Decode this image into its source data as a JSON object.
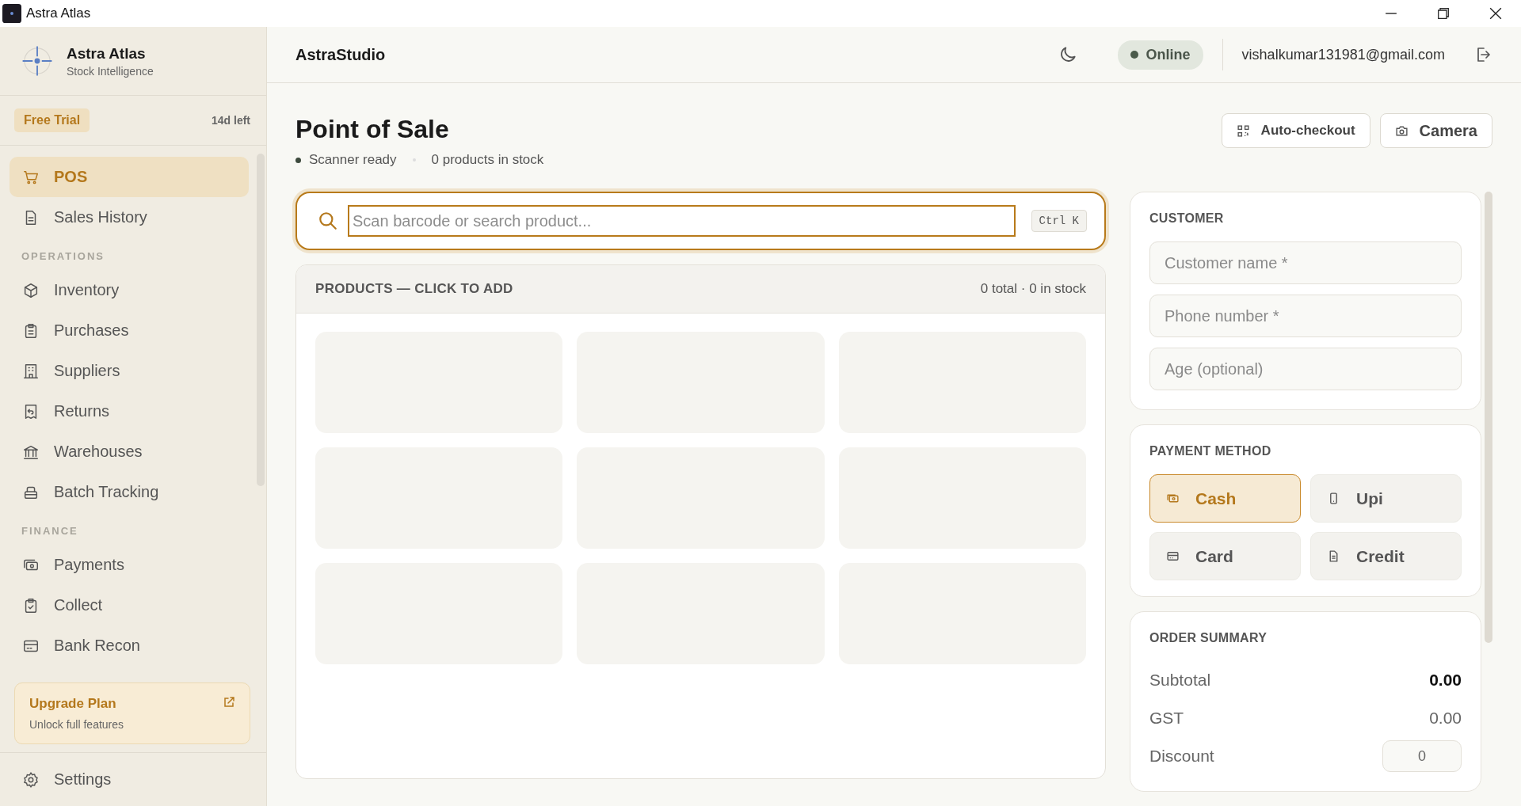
{
  "titlebar": {
    "title": "Astra Atlas"
  },
  "brand": {
    "name": "Astra Atlas",
    "tagline": "Stock Intelligence"
  },
  "trial": {
    "badge": "Free Trial",
    "remaining": "14d left"
  },
  "nav": [
    {
      "items": [
        {
          "label": "POS",
          "selected": true
        },
        {
          "label": "Sales History",
          "selected": false
        }
      ]
    },
    {
      "heading": "OPERATIONS",
      "items": [
        {
          "label": "Inventory",
          "selected": false
        },
        {
          "label": "Purchases",
          "selected": false
        },
        {
          "label": "Suppliers",
          "selected": false
        },
        {
          "label": "Returns",
          "selected": false
        },
        {
          "label": "Warehouses",
          "selected": false
        },
        {
          "label": "Batch Tracking",
          "selected": false
        }
      ]
    },
    {
      "heading": "FINANCE",
      "items": [
        {
          "label": "Payments",
          "selected": false
        },
        {
          "label": "Collect",
          "selected": false
        },
        {
          "label": "Bank Recon",
          "selected": false
        }
      ]
    }
  ],
  "upgrade": {
    "title": "Upgrade Plan",
    "subtitle": "Unlock full features"
  },
  "settings": {
    "label": "Settings"
  },
  "header": {
    "app_name": "AstraStudio",
    "status": "Online",
    "online": true,
    "email": "vishalkumar131981@gmail.com"
  },
  "page": {
    "title": "Point of Sale",
    "scanner": "Scanner ready",
    "stock": "0 products in stock",
    "buttons": [
      {
        "kind": "qr",
        "label": "Auto-checkout"
      },
      {
        "kind": "camera",
        "label": "Camera"
      }
    ]
  },
  "search": {
    "placeholder": "Scan barcode or search product...",
    "shortcut": "Ctrl K"
  },
  "products": {
    "heading": "PRODUCTS — CLICK TO ADD",
    "count": "0 total · 0 in stock",
    "loading": true
  },
  "customer": {
    "heading": "CUSTOMER",
    "fields": [
      {
        "placeholder": "Customer name *"
      },
      {
        "placeholder": "Phone number *"
      },
      {
        "placeholder": "Age (optional)"
      }
    ]
  },
  "payment": {
    "heading": "PAYMENT METHOD",
    "methods": [
      {
        "kind": "cash",
        "label": "Cash",
        "selected": true
      },
      {
        "kind": "upi",
        "label": "Upi",
        "selected": false
      },
      {
        "kind": "card",
        "label": "Card",
        "selected": false
      },
      {
        "kind": "credit",
        "label": "Credit",
        "selected": false
      }
    ]
  },
  "summary": {
    "heading": "ORDER SUMMARY",
    "rows": [
      {
        "kind": "amount",
        "label": "Subtotal",
        "value": "0.00",
        "strong": true
      },
      {
        "kind": "amount",
        "label": "GST",
        "value": "0.00",
        "strong": false
      },
      {
        "kind": "input",
        "label": "Discount",
        "value": "0"
      }
    ]
  }
}
